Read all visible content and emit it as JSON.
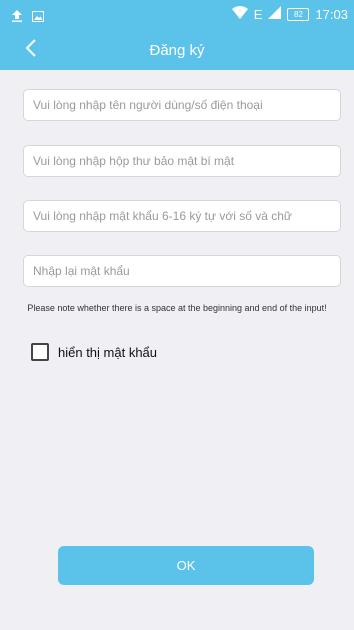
{
  "status_bar": {
    "time": "17:03",
    "battery": "82",
    "network": "E",
    "icons": [
      "upload-icon",
      "image-icon",
      "wifi-icon",
      "signal-icon",
      "battery-icon"
    ]
  },
  "header": {
    "title": "Đăng ký",
    "back_icon": "chevron-left-icon",
    "color": "#5bc3ea"
  },
  "form": {
    "username_placeholder": "Vui lòng nhập tên người dùng/số điện thoại",
    "email_placeholder": "Vui lòng nhập hộp thư bảo mật bí mật",
    "password_placeholder": "Vui lòng nhập mật khẩu 6-16 ký tự với số và chữ",
    "confirm_password_placeholder": "Nhập lại mật khẩu",
    "note": "Please note whether there is a space at the beginning and end of the input!",
    "show_password_label": "hiển thị mật khẩu",
    "show_password_checked": false,
    "submit_label": "OK"
  }
}
